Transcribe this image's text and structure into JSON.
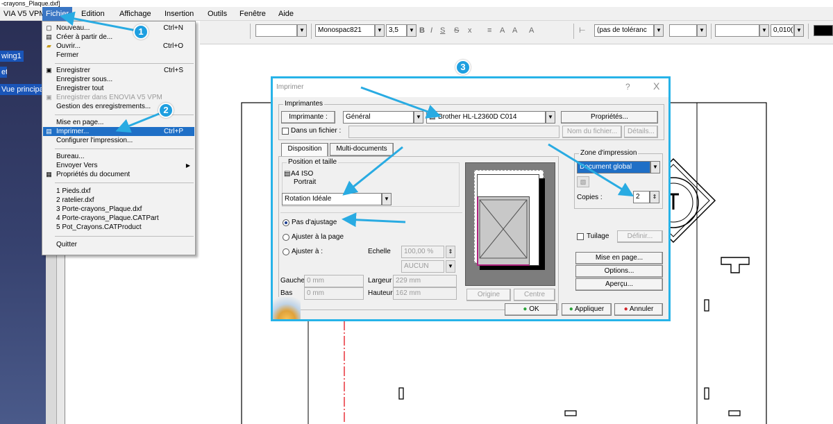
{
  "window": {
    "title": "-crayons_Plaque.dxf]"
  },
  "menubar": {
    "app_name": "VIA V5 VPM",
    "items": [
      "Fichier",
      "Edition",
      "Affichage",
      "Insertion",
      "Outils",
      "Fenêtre",
      "Aide"
    ],
    "active": "Fichier"
  },
  "toolbar": {
    "font_name": "Monospac821",
    "font_size": "3,5",
    "tolerance": "(pas de toléranc",
    "precision": "0,010("
  },
  "tree": {
    "items": [
      "wing1",
      "et",
      "Vue principa"
    ]
  },
  "file_menu": {
    "items": [
      {
        "label": "Nouveau...",
        "shortcut": "Ctrl+N"
      },
      {
        "label": "Créer à partir de...",
        "shortcut": ""
      },
      {
        "label": "Ouvrir...",
        "shortcut": "Ctrl+O"
      },
      {
        "label": "Fermer",
        "shortcut": ""
      },
      {
        "label": "Enregistrer",
        "shortcut": "Ctrl+S"
      },
      {
        "label": "Enregistrer sous...",
        "shortcut": ""
      },
      {
        "label": "Enregistrer tout",
        "shortcut": ""
      },
      {
        "label": "Enregistrer dans ENOVIA V5 VPM",
        "shortcut": ""
      },
      {
        "label": "Gestion des enregistrements...",
        "shortcut": ""
      },
      {
        "label": "Mise en page...",
        "shortcut": ""
      },
      {
        "label": "Imprimer...",
        "shortcut": "Ctrl+P"
      },
      {
        "label": "Configurer l'impression...",
        "shortcut": ""
      },
      {
        "label": "Bureau...",
        "shortcut": ""
      },
      {
        "label": "Envoyer Vers",
        "shortcut": ""
      },
      {
        "label": "Propriétés du document",
        "shortcut": ""
      },
      {
        "label": "1 Pieds.dxf",
        "shortcut": ""
      },
      {
        "label": "2 ratelier.dxf",
        "shortcut": ""
      },
      {
        "label": "3 Porte-crayons_Plaque.dxf",
        "shortcut": ""
      },
      {
        "label": "4 Porte-crayons_Plaque.CATPart",
        "shortcut": ""
      },
      {
        "label": "5 Pot_Crayons.CATProduct",
        "shortcut": ""
      },
      {
        "label": "Quitter",
        "shortcut": ""
      }
    ]
  },
  "dialog": {
    "title": "Imprimer",
    "help": "?",
    "close": "X",
    "printers_group": "Imprimantes",
    "printer_button": "Imprimante :",
    "printer_category": "Général",
    "printer_name": "Brother HL-L2360D C014",
    "properties_button": "Propriétés...",
    "to_file_label": "Dans un fichier :",
    "filename_button": "Nom du fichier...",
    "details_button": "Détails...",
    "tabs": [
      "Disposition",
      "Multi-documents"
    ],
    "position_group": "Position et taille",
    "paper": "A4 ISO",
    "orientation": "Portrait",
    "rotation": "Rotation Idéale",
    "fit_none": "Pas d'ajustage",
    "fit_page": "Ajuster à la page",
    "fit_to": "Ajuster à :",
    "scale_label": "Echelle",
    "scale_value": "100,00 %",
    "scale_mode": "AUCUN",
    "left_label": "Gauche",
    "left_value": "0 mm",
    "bottom_label": "Bas",
    "bottom_value": "0 mm",
    "width_label": "Largeur",
    "width_value": "229 mm",
    "height_label": "Hauteur",
    "height_value": "162 mm",
    "origin_button": "Origine",
    "center_button": "Centre",
    "area_group": "Zone d'impression",
    "area_value": "Document global",
    "copies_label": "Copies :",
    "copies_value": "2",
    "tiling_label": "Tuilage",
    "define_button": "Définir...",
    "page_setup_button": "Mise en page...",
    "options_button": "Options...",
    "preview_button": "Aperçu...",
    "ok_button": "OK",
    "apply_button": "Appliquer",
    "cancel_button": "Annuler"
  },
  "callouts": [
    "1",
    "2",
    "3"
  ],
  "colors": {
    "accent_blue": "#27b3e8",
    "menu_highlight": "#1f6fc6",
    "drawing_red": "#e8323a"
  }
}
